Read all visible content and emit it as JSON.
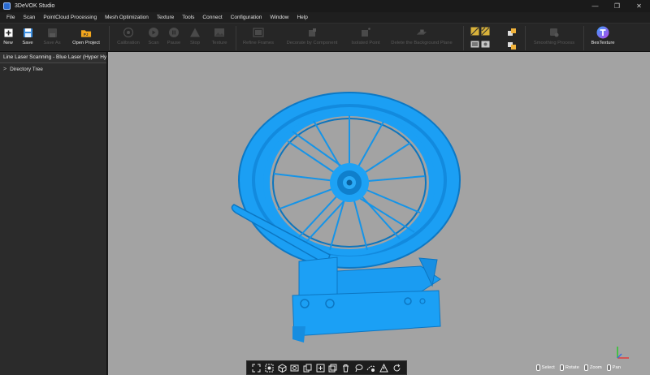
{
  "window": {
    "title": "3DeVOK Studio",
    "controls": [
      "—",
      "❐",
      "✕"
    ]
  },
  "menu": [
    "File",
    "Scan",
    "PointCloud Processing",
    "Mesh Optimization",
    "Texture",
    "Tools",
    "Connect",
    "Configuration",
    "Window",
    "Help"
  ],
  "toolbar": {
    "new": "New",
    "save": "Save",
    "save_as": "Save As",
    "open_project": "Open Project",
    "open_project_badge": "PJ",
    "calibration": "Calibration",
    "scan": "Scan",
    "pause": "Pause",
    "stop": "Stop",
    "texture": "Texture",
    "refine_frames": "Refine Frames",
    "decorate_by_component": "Decorate by Component",
    "isolated_point": "Isolated Point",
    "delete_background_plane": "Delete the Background Plane",
    "smoothing_process": "Smoothing Process",
    "bes_texture": "BesTexture"
  },
  "left_panel": {
    "header": "Line Laser Scanning - Blue Laser (Hyper Hy",
    "tree_item": "Directory Tree"
  },
  "hints": {
    "select": "Select",
    "rotate": "Rotate",
    "zoom": "Zoom",
    "pan": "Pan"
  },
  "bottom_tools": [
    "fit-view-icon",
    "select-region-icon",
    "view-cube-icon",
    "isolate-view-icon",
    "copy-icon",
    "paste-icon",
    "layers-icon",
    "delete-icon",
    "lasso-icon",
    "region-grow-icon",
    "triangle-icon",
    "refresh-icon"
  ],
  "colors": {
    "model": "#1a9ff5",
    "model_dark": "#0b6fb4",
    "viewport": "#a3a3a3",
    "accent": "#2a6bd1"
  }
}
